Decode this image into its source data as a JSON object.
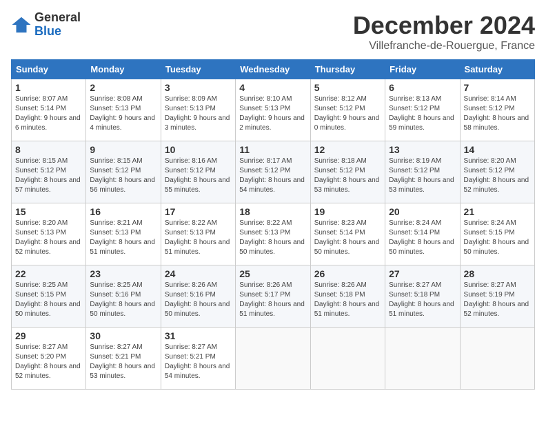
{
  "logo": {
    "general": "General",
    "blue": "Blue"
  },
  "title": {
    "month_year": "December 2024",
    "location": "Villefranche-de-Rouergue, France"
  },
  "headers": [
    "Sunday",
    "Monday",
    "Tuesday",
    "Wednesday",
    "Thursday",
    "Friday",
    "Saturday"
  ],
  "weeks": [
    [
      {
        "day": "1",
        "sunrise": "Sunrise: 8:07 AM",
        "sunset": "Sunset: 5:14 PM",
        "daylight": "Daylight: 9 hours and 6 minutes."
      },
      {
        "day": "2",
        "sunrise": "Sunrise: 8:08 AM",
        "sunset": "Sunset: 5:13 PM",
        "daylight": "Daylight: 9 hours and 4 minutes."
      },
      {
        "day": "3",
        "sunrise": "Sunrise: 8:09 AM",
        "sunset": "Sunset: 5:13 PM",
        "daylight": "Daylight: 9 hours and 3 minutes."
      },
      {
        "day": "4",
        "sunrise": "Sunrise: 8:10 AM",
        "sunset": "Sunset: 5:13 PM",
        "daylight": "Daylight: 9 hours and 2 minutes."
      },
      {
        "day": "5",
        "sunrise": "Sunrise: 8:12 AM",
        "sunset": "Sunset: 5:12 PM",
        "daylight": "Daylight: 9 hours and 0 minutes."
      },
      {
        "day": "6",
        "sunrise": "Sunrise: 8:13 AM",
        "sunset": "Sunset: 5:12 PM",
        "daylight": "Daylight: 8 hours and 59 minutes."
      },
      {
        "day": "7",
        "sunrise": "Sunrise: 8:14 AM",
        "sunset": "Sunset: 5:12 PM",
        "daylight": "Daylight: 8 hours and 58 minutes."
      }
    ],
    [
      {
        "day": "8",
        "sunrise": "Sunrise: 8:15 AM",
        "sunset": "Sunset: 5:12 PM",
        "daylight": "Daylight: 8 hours and 57 minutes."
      },
      {
        "day": "9",
        "sunrise": "Sunrise: 8:15 AM",
        "sunset": "Sunset: 5:12 PM",
        "daylight": "Daylight: 8 hours and 56 minutes."
      },
      {
        "day": "10",
        "sunrise": "Sunrise: 8:16 AM",
        "sunset": "Sunset: 5:12 PM",
        "daylight": "Daylight: 8 hours and 55 minutes."
      },
      {
        "day": "11",
        "sunrise": "Sunrise: 8:17 AM",
        "sunset": "Sunset: 5:12 PM",
        "daylight": "Daylight: 8 hours and 54 minutes."
      },
      {
        "day": "12",
        "sunrise": "Sunrise: 8:18 AM",
        "sunset": "Sunset: 5:12 PM",
        "daylight": "Daylight: 8 hours and 53 minutes."
      },
      {
        "day": "13",
        "sunrise": "Sunrise: 8:19 AM",
        "sunset": "Sunset: 5:12 PM",
        "daylight": "Daylight: 8 hours and 53 minutes."
      },
      {
        "day": "14",
        "sunrise": "Sunrise: 8:20 AM",
        "sunset": "Sunset: 5:12 PM",
        "daylight": "Daylight: 8 hours and 52 minutes."
      }
    ],
    [
      {
        "day": "15",
        "sunrise": "Sunrise: 8:20 AM",
        "sunset": "Sunset: 5:13 PM",
        "daylight": "Daylight: 8 hours and 52 minutes."
      },
      {
        "day": "16",
        "sunrise": "Sunrise: 8:21 AM",
        "sunset": "Sunset: 5:13 PM",
        "daylight": "Daylight: 8 hours and 51 minutes."
      },
      {
        "day": "17",
        "sunrise": "Sunrise: 8:22 AM",
        "sunset": "Sunset: 5:13 PM",
        "daylight": "Daylight: 8 hours and 51 minutes."
      },
      {
        "day": "18",
        "sunrise": "Sunrise: 8:22 AM",
        "sunset": "Sunset: 5:13 PM",
        "daylight": "Daylight: 8 hours and 50 minutes."
      },
      {
        "day": "19",
        "sunrise": "Sunrise: 8:23 AM",
        "sunset": "Sunset: 5:14 PM",
        "daylight": "Daylight: 8 hours and 50 minutes."
      },
      {
        "day": "20",
        "sunrise": "Sunrise: 8:24 AM",
        "sunset": "Sunset: 5:14 PM",
        "daylight": "Daylight: 8 hours and 50 minutes."
      },
      {
        "day": "21",
        "sunrise": "Sunrise: 8:24 AM",
        "sunset": "Sunset: 5:15 PM",
        "daylight": "Daylight: 8 hours and 50 minutes."
      }
    ],
    [
      {
        "day": "22",
        "sunrise": "Sunrise: 8:25 AM",
        "sunset": "Sunset: 5:15 PM",
        "daylight": "Daylight: 8 hours and 50 minutes."
      },
      {
        "day": "23",
        "sunrise": "Sunrise: 8:25 AM",
        "sunset": "Sunset: 5:16 PM",
        "daylight": "Daylight: 8 hours and 50 minutes."
      },
      {
        "day": "24",
        "sunrise": "Sunrise: 8:26 AM",
        "sunset": "Sunset: 5:16 PM",
        "daylight": "Daylight: 8 hours and 50 minutes."
      },
      {
        "day": "25",
        "sunrise": "Sunrise: 8:26 AM",
        "sunset": "Sunset: 5:17 PM",
        "daylight": "Daylight: 8 hours and 51 minutes."
      },
      {
        "day": "26",
        "sunrise": "Sunrise: 8:26 AM",
        "sunset": "Sunset: 5:18 PM",
        "daylight": "Daylight: 8 hours and 51 minutes."
      },
      {
        "day": "27",
        "sunrise": "Sunrise: 8:27 AM",
        "sunset": "Sunset: 5:18 PM",
        "daylight": "Daylight: 8 hours and 51 minutes."
      },
      {
        "day": "28",
        "sunrise": "Sunrise: 8:27 AM",
        "sunset": "Sunset: 5:19 PM",
        "daylight": "Daylight: 8 hours and 52 minutes."
      }
    ],
    [
      {
        "day": "29",
        "sunrise": "Sunrise: 8:27 AM",
        "sunset": "Sunset: 5:20 PM",
        "daylight": "Daylight: 8 hours and 52 minutes."
      },
      {
        "day": "30",
        "sunrise": "Sunrise: 8:27 AM",
        "sunset": "Sunset: 5:21 PM",
        "daylight": "Daylight: 8 hours and 53 minutes."
      },
      {
        "day": "31",
        "sunrise": "Sunrise: 8:27 AM",
        "sunset": "Sunset: 5:21 PM",
        "daylight": "Daylight: 8 hours and 54 minutes."
      },
      null,
      null,
      null,
      null
    ]
  ]
}
